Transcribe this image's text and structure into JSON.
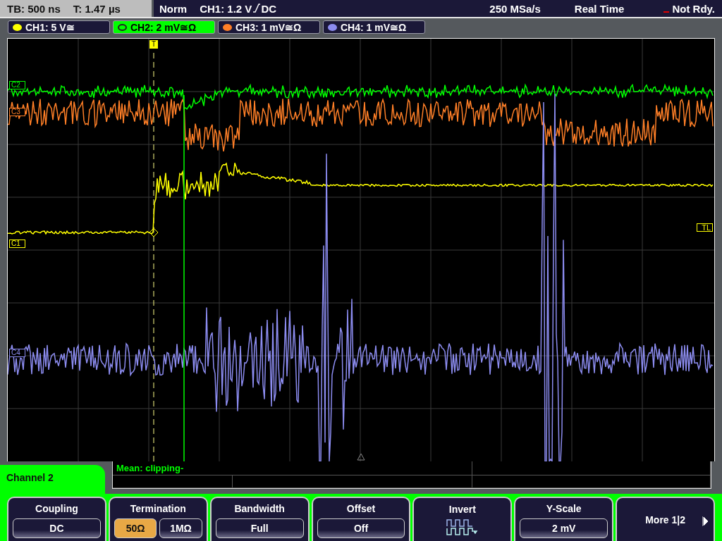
{
  "status_bar": {
    "timebase": "TB: 500 ns",
    "trigger_time": "T: 1.47 µs",
    "mode": "Norm",
    "trigger_level": "CH1: 1.2 V",
    "trigger_coupling": "DC",
    "sample_rate": "250 MSa/s",
    "acquisition": "Real Time",
    "state": "Not Rdy."
  },
  "channels": [
    {
      "label": "CH1: 5 V≅",
      "color": "#ffff00",
      "selected": false
    },
    {
      "label": "CH2: 2 mV≅Ω",
      "color": "#00ff00",
      "selected": true
    },
    {
      "label": "CH3: 1 mV≅Ω",
      "color": "#ff7f27",
      "selected": false
    },
    {
      "label": "CH4: 1 mV≅Ω",
      "color": "#8c8cf0",
      "selected": false
    }
  ],
  "scope": {
    "trigger_marker": "T",
    "trigger_level_marker": "TL",
    "channel_markers": [
      {
        "label": "C2",
        "color": "#00ff00"
      },
      {
        "label": "C3",
        "color": "#ff7f27"
      },
      {
        "label": "C1",
        "color": "#ffff00"
      },
      {
        "label": "C4",
        "color": "#8c8cf0"
      }
    ]
  },
  "measurement": {
    "text": "Mean: clipping-"
  },
  "menu": {
    "title": "Channel 2",
    "softkeys": [
      {
        "kind": "value",
        "label": "Coupling",
        "value": "DC"
      },
      {
        "kind": "toggle",
        "label": "Termination",
        "options": [
          {
            "label": "50Ω",
            "selected": true
          },
          {
            "label": "1MΩ",
            "selected": false
          }
        ]
      },
      {
        "kind": "value",
        "label": "Bandwidth",
        "value": "Full"
      },
      {
        "kind": "value",
        "label": "Offset",
        "value": "Off"
      },
      {
        "kind": "invert",
        "label": "Invert"
      },
      {
        "kind": "value",
        "label": "Y-Scale",
        "value": "2 mV"
      },
      {
        "kind": "more",
        "label": "More 1|2"
      }
    ]
  }
}
